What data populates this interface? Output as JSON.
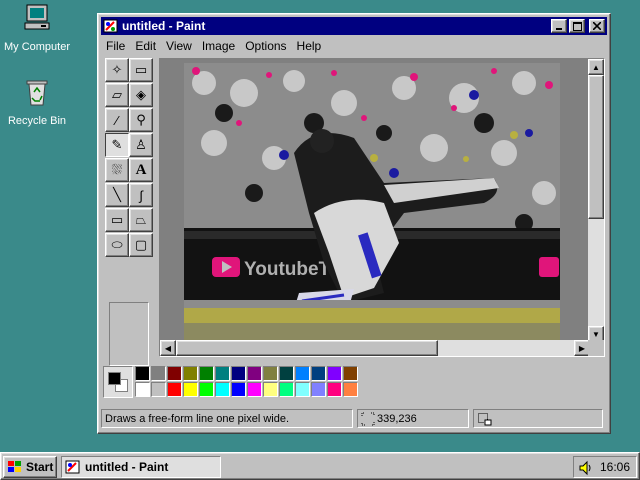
{
  "desktop": {
    "icons": [
      {
        "label": "My Computer",
        "icon": "computer-icon"
      },
      {
        "label": "Recycle Bin",
        "icon": "recycle-bin-icon"
      }
    ],
    "background_color": "#3a8a8a"
  },
  "window": {
    "title": "untitled - Paint",
    "app_icon": "paint-icon",
    "controls": {
      "minimize": "minimize-icon",
      "maximize": "maximize-icon",
      "close": "close-icon"
    },
    "menu": [
      "File",
      "Edit",
      "View",
      "Image",
      "Options",
      "Help"
    ]
  },
  "toolbox": {
    "tools": [
      {
        "name": "free-form-select",
        "glyph": "✧"
      },
      {
        "name": "select",
        "glyph": "▭"
      },
      {
        "name": "eraser",
        "glyph": "▱"
      },
      {
        "name": "fill-with-color",
        "glyph": "◈"
      },
      {
        "name": "pick-color",
        "glyph": "⁄"
      },
      {
        "name": "magnifier",
        "glyph": "⚲"
      },
      {
        "name": "pencil",
        "glyph": "✎"
      },
      {
        "name": "brush",
        "glyph": "♙"
      },
      {
        "name": "airbrush",
        "glyph": "⛆"
      },
      {
        "name": "text",
        "glyph": "A"
      },
      {
        "name": "line",
        "glyph": "╲"
      },
      {
        "name": "curve",
        "glyph": "∫"
      },
      {
        "name": "rectangle",
        "glyph": "▭"
      },
      {
        "name": "polygon",
        "glyph": "⏢"
      },
      {
        "name": "ellipse",
        "glyph": "⬭"
      },
      {
        "name": "rounded-rectangle",
        "glyph": "▢"
      }
    ],
    "selected_tool": "pencil"
  },
  "canvas": {
    "image_overlay_text": "YoutubeT"
  },
  "palette": {
    "foreground": "#000000",
    "background": "#ffffff",
    "colors": [
      "#000000",
      "#808080",
      "#800000",
      "#808000",
      "#008000",
      "#008080",
      "#000080",
      "#800080",
      "#808040",
      "#004040",
      "#0080ff",
      "#004080",
      "#8000ff",
      "#804000",
      "#ffffff",
      "#c0c0c0",
      "#ff0000",
      "#ffff00",
      "#00ff00",
      "#00ffff",
      "#0000ff",
      "#ff00ff",
      "#ffff80",
      "#00ff80",
      "#80ffff",
      "#8080ff",
      "#ff0080",
      "#ff8040"
    ]
  },
  "statusbar": {
    "help_text": "Draws a free-form line one pixel wide.",
    "coords": "339,236",
    "size": ""
  },
  "taskbar": {
    "start_label": "Start",
    "task_label": "untitled - Paint",
    "time": "16:06"
  }
}
